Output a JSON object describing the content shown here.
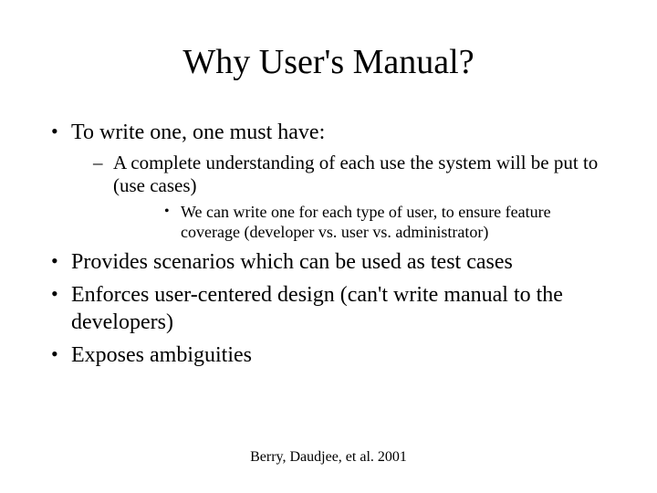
{
  "title": "Why User's Manual?",
  "b1": "To write one, one must have:",
  "b1_1": "A complete understanding of each use the system will be put to (use cases)",
  "b1_1_1": "We can write one for each type of user, to ensure feature coverage (developer vs. user vs. administrator)",
  "b2": "Provides scenarios which can be used as test cases",
  "b3": "Enforces user-centered design (can't write manual to the developers)",
  "b4": "Exposes ambiguities",
  "citation": "Berry, Daudjee, et al. 2001"
}
